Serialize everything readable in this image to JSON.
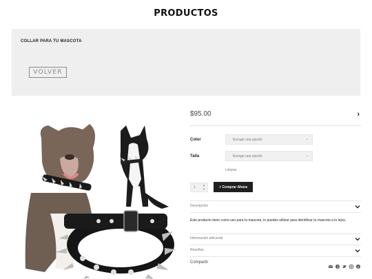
{
  "page": {
    "title": "PRODUCTOS"
  },
  "hero": {
    "product_title": "COLLAR PARA TU MASCOTA",
    "back_label": "VOLVER"
  },
  "product": {
    "price": "$95.00",
    "options": [
      {
        "label": "Color",
        "select_value": "Escoge una opción"
      },
      {
        "label": "Talla",
        "select_value": "Escoge una opción"
      }
    ],
    "clear_label": "Limpiar",
    "quantity": "1",
    "buy_label": "+ Comprar Ahora"
  },
  "accordion": {
    "description_label": "Descripción",
    "description_text": "Este producto tiene como uso para tu mascota, lo puedes utilizar para identificar tu mascota a lo lejos.",
    "additional_label": "Información adicional",
    "reviews_label": "Reseñas"
  },
  "share": {
    "label": "Compartir",
    "icons": [
      "envelope-icon",
      "facebook-icon",
      "twitter-icon",
      "instagram-icon",
      "pinterest-icon"
    ]
  },
  "colors": {
    "button_dark": "#1f1f1f",
    "hero_bg": "#efefef",
    "collar": "#1a1a1a",
    "dog_brown": "#7a6658"
  }
}
